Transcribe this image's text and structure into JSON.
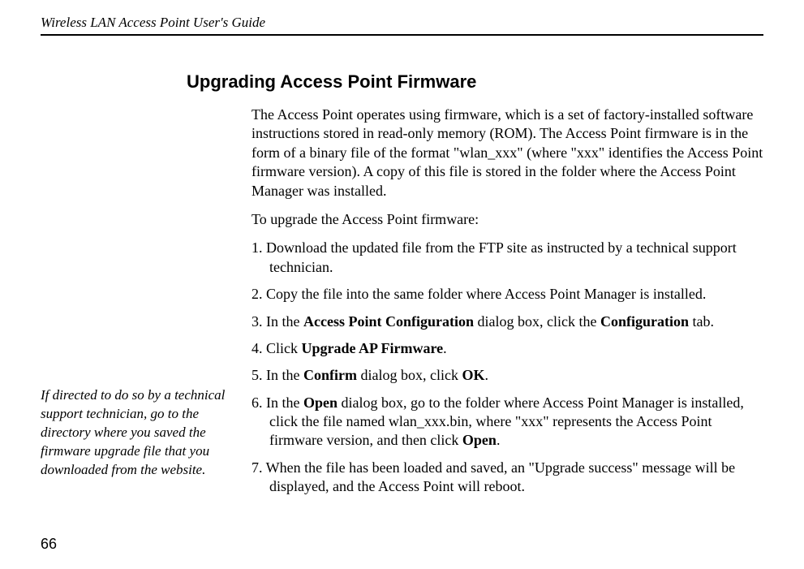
{
  "header": {
    "title": "Wireless LAN Access Point User's Guide"
  },
  "sidebar": {
    "note": "If directed to do so by a technical support technician, go to the directory where you saved the firmware upgrade file that you downloaded from the website."
  },
  "main": {
    "title": "Upgrading Access Point Firmware",
    "intro": "The Access Point operates using firmware, which is a set of factory-installed software instructions stored in read-only memory (ROM). The Access Point firmware is in the form of a binary file of the format \"wlan_xxx\" (where \"xxx\" identifies the Access Point firmware version). A copy of this file is stored in the folder where the Access Point Manager was installed.",
    "subintro": "To upgrade the Access Point firmware:",
    "steps": {
      "s1": "1. Download the updated file from the FTP site as instructed by a technical support technician.",
      "s2": "2. Copy the file into the same folder where Access Point Manager is installed.",
      "s3_pre": "3. In the ",
      "s3_b1": "Access Point Configuration",
      "s3_mid": " dialog box, click the ",
      "s3_b2": "Configuration",
      "s3_post": " tab.",
      "s4_pre": "4. Click ",
      "s4_b1": "Upgrade AP Firmware",
      "s4_post": ".",
      "s5_pre": "5. In the ",
      "s5_b1": "Confirm",
      "s5_mid": " dialog box, click ",
      "s5_b2": "OK",
      "s5_post": ".",
      "s6_pre": "6. In the ",
      "s6_b1": "Open",
      "s6_mid": " dialog box, go to the folder where Access Point Manager is installed, click the file named wlan_xxx.bin, where \"xxx\" represents the Access Point firmware version, and then click ",
      "s6_b2": "Open",
      "s6_post": ".",
      "s7": "7. When the file has been loaded and saved, an \"Upgrade success\" message will be displayed, and the Access Point will reboot."
    }
  },
  "footer": {
    "page": "66"
  }
}
